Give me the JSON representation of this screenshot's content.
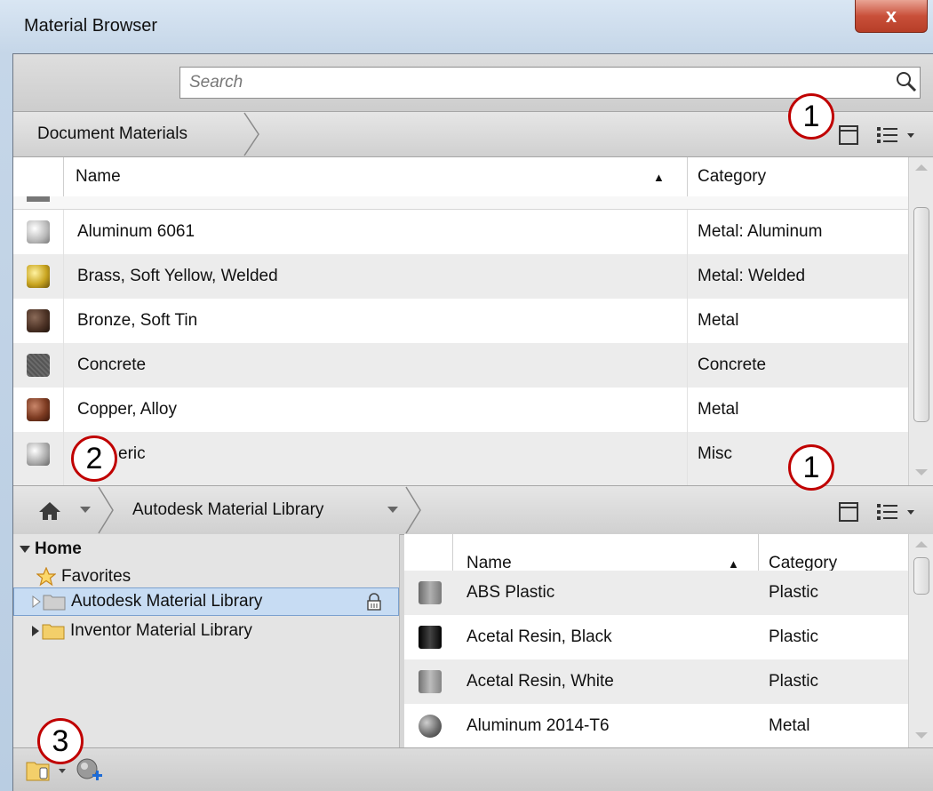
{
  "window": {
    "title": "Material Browser",
    "close_glyph": "x"
  },
  "search": {
    "placeholder": "Search",
    "value": ""
  },
  "document_panel": {
    "breadcrumb": "Document Materials",
    "columns": {
      "name": "Name",
      "category": "Category",
      "sort_glyph": "▲"
    },
    "rows": [
      {
        "name": "Aluminum 6061",
        "category": "Metal: Aluminum",
        "swatch": "#b8b8b8"
      },
      {
        "name": "Brass, Soft Yellow, Welded",
        "category": "Metal: Welded",
        "swatch": "#c9a521"
      },
      {
        "name": "Bronze, Soft Tin",
        "category": "Metal",
        "swatch": "#4d3326"
      },
      {
        "name": "Concrete",
        "category": "Concrete",
        "swatch": "#5f5f5f"
      },
      {
        "name": "Copper, Alloy",
        "category": "Metal",
        "swatch": "#7d3b22"
      },
      {
        "name": "eric",
        "category": "Misc",
        "swatch": "#a8a8a8"
      }
    ]
  },
  "library_panel": {
    "breadcrumb": "Autodesk Material Library",
    "tree": {
      "home": "Home",
      "favorites": "Favorites",
      "autodesk_library": "Autodesk Material Library",
      "inventor_library": "Inventor Material Library"
    },
    "columns": {
      "name": "Name",
      "category": "Category",
      "sort_glyph": "▲"
    },
    "rows": [
      {
        "name": "ABS Plastic",
        "category": "Plastic",
        "swatch": "#8a8a8a"
      },
      {
        "name": "Acetal Resin, Black",
        "category": "Plastic",
        "swatch": "#151515"
      },
      {
        "name": "Acetal Resin, White",
        "category": "Plastic",
        "swatch": "#9a9a9a"
      },
      {
        "name": "Aluminum 2014-T6",
        "category": "Metal",
        "swatch": "#6e6e6e"
      }
    ]
  },
  "callouts": {
    "one_top": "1",
    "one_mid": "1",
    "two": "2",
    "three": "3"
  },
  "colors": {
    "callout_border": "#c00000",
    "selection": "#c7dcf3",
    "close_button": "#c9503a"
  },
  "icons": [
    "search-icon",
    "panel-view-icon",
    "list-view-icon",
    "home-icon",
    "star-icon",
    "folder-icon",
    "lock-icon",
    "library-menu-icon",
    "create-material-icon"
  ]
}
